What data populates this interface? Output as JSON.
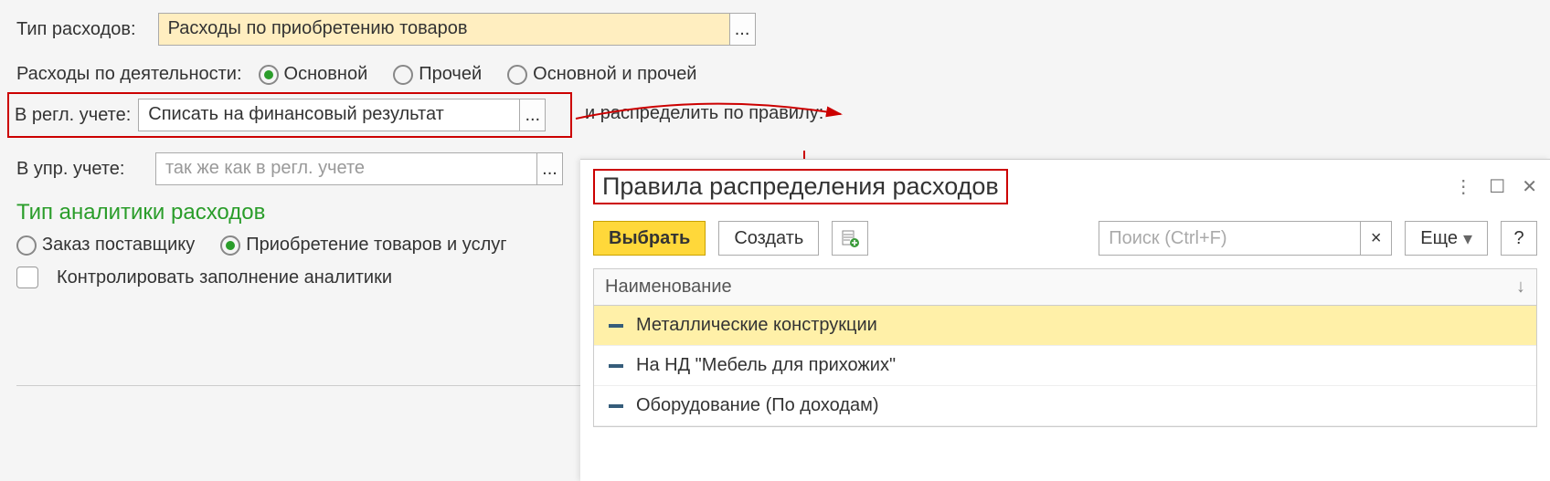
{
  "form": {
    "expense_type_label": "Тип расходов:",
    "expense_type_value": "Расходы по приобретению товаров",
    "activity_label": "Расходы по деятельности:",
    "activity_options": {
      "main": "Основной",
      "other": "Прочей",
      "both": "Основной и прочей"
    },
    "reg_label": "В регл. учете:",
    "reg_value": "Списать на финансовый результат",
    "rule_label": "и распределить по правилу:",
    "mgmt_label": "В упр. учете:",
    "mgmt_placeholder": "так же как в регл. учете",
    "analytics_title": "Тип аналитики расходов",
    "analytics_options": {
      "supplier": "Заказ поставщику",
      "purchase": "Приобретение товаров и услуг"
    },
    "control_label": "Контролировать заполнение аналитики"
  },
  "dialog": {
    "title": "Правила распределения расходов",
    "select_btn": "Выбрать",
    "create_btn": "Создать",
    "search_placeholder": "Поиск (Ctrl+F)",
    "more_btn": "Еще",
    "help_btn": "?",
    "column": "Наименование",
    "rows": [
      "Металлические конструкции",
      "На НД \"Мебель для прихожих\"",
      "Оборудование (По доходам)"
    ]
  },
  "icons": {
    "dots": "...",
    "clear": "×",
    "kebab": "⋮",
    "window": "☐",
    "close": "✕",
    "caret": "▾",
    "down": "↓",
    "ext": "⧉"
  }
}
